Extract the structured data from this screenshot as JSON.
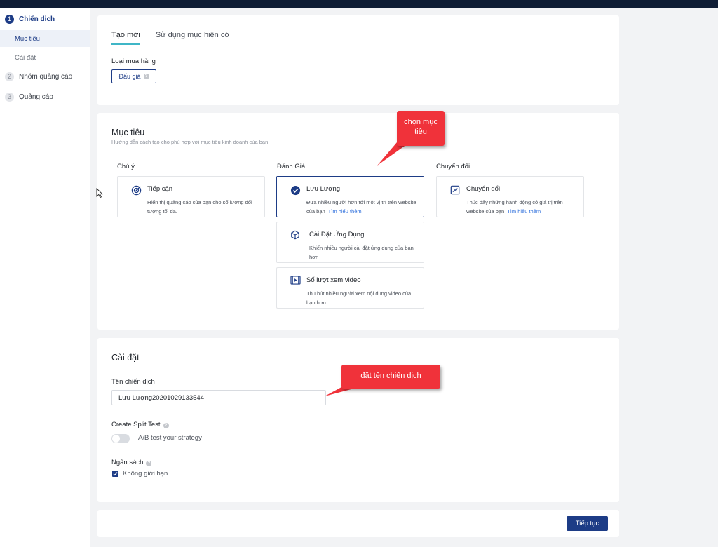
{
  "sidebar": {
    "steps": [
      {
        "num": "1",
        "label": "Chiến dịch"
      },
      {
        "num": "2",
        "label": "Nhóm quảng cáo"
      },
      {
        "num": "3",
        "label": "Quảng cáo"
      }
    ],
    "substeps": [
      {
        "label": "Mục tiêu"
      },
      {
        "label": "Cài đặt"
      }
    ]
  },
  "purchase": {
    "tabs": [
      "Tạo mới",
      "Sử dụng mục hiện có"
    ],
    "type_label": "Loại mua hàng",
    "type_value": "Đấu giá"
  },
  "objective": {
    "title": "Mục tiêu",
    "subtitle": "Hướng dẫn cách tạo cho phù hợp với mục tiêu kinh doanh của bạn",
    "columns": [
      "Chú ý",
      "Đánh Giá",
      "Chuyển đổi"
    ],
    "options": {
      "reach": {
        "title": "Tiếp cận",
        "desc": "Hiển thị quảng cáo của bạn cho số lượng đối tượng tối đa.",
        "icon": "target-icon"
      },
      "traffic": {
        "title": "Lưu Lượng",
        "desc": "Đưa nhiều người hơn tới một vị trí trên website của bạn",
        "link": "Tìm hiểu thêm",
        "icon": "check-circle-icon"
      },
      "conversions": {
        "title": "Chuyển đổi",
        "desc": "Thúc đẩy những hành động có giá trị trên website của bạn",
        "link": "Tìm hiểu thêm",
        "icon": "trend-up-icon"
      },
      "app_install": {
        "title": "Cài Đặt Ứng Dụng",
        "desc": "Khiến nhiều người cài đặt ứng dụng của bạn hơn",
        "icon": "cube-icon"
      },
      "video_views": {
        "title": "Số lượt xem video",
        "desc": "Thu hút nhiều người xem nội dung video của bạn hơn",
        "icon": "video-icon"
      }
    }
  },
  "settings": {
    "title": "Cài đặt",
    "campaign_name_label": "Tên chiến dịch",
    "campaign_name_value": "Lưu Lượng20201029133544",
    "split_test_label": "Create Split Test",
    "split_test_desc": "A/B test your strategy",
    "split_test_enabled": false,
    "budget_label": "Ngân sách",
    "budget_unlimited_label": "Không giới hạn",
    "budget_unlimited_checked": true
  },
  "footer": {
    "continue_label": "Tiếp tục"
  },
  "annotations": {
    "callout_objective": "chọn mục tiêu",
    "callout_name": "đặt tên chiến dịch"
  },
  "colors": {
    "accent": "#1d3c86",
    "tab_underline": "#3fb6c7",
    "callout": "#f0323a",
    "link": "#2e6fdc"
  }
}
